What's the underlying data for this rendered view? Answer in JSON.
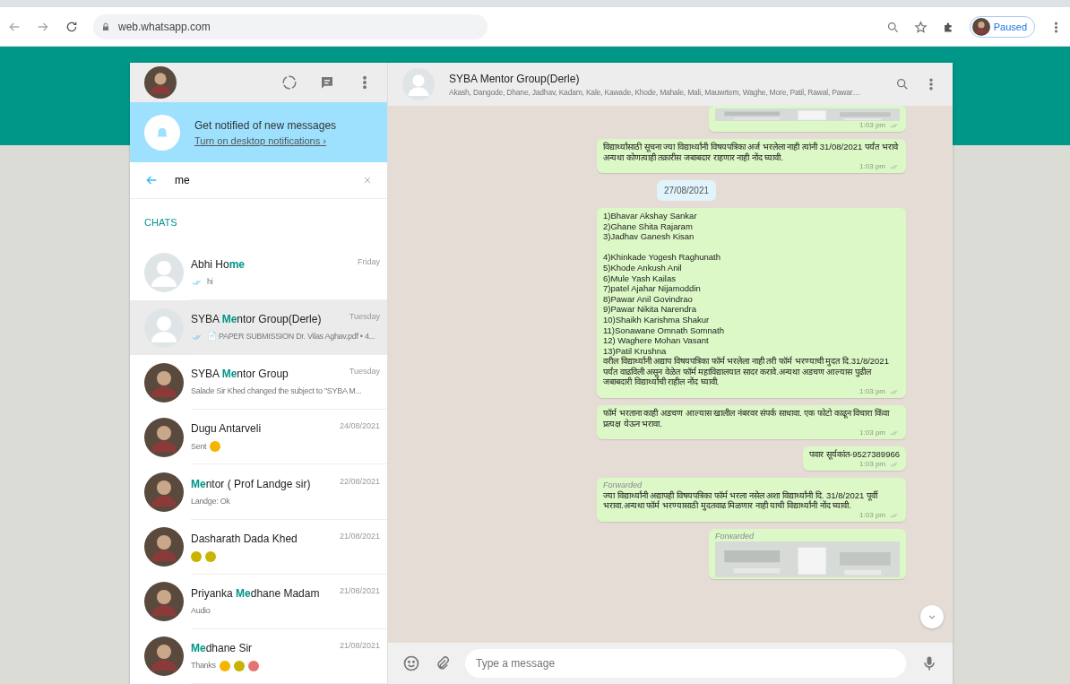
{
  "browser": {
    "url": "web.whatsapp.com",
    "profile_button": "Paused"
  },
  "sidebar": {
    "notification": {
      "title": "Get notified of new messages",
      "link": "Turn on desktop notifications ›"
    },
    "search": {
      "value": "me"
    },
    "section_label": "CHATS",
    "chats": [
      {
        "name_parts": [
          {
            "text": "Abhi Ho",
            "match": false
          },
          {
            "text": "me",
            "match": true
          }
        ],
        "time": "Friday",
        "preview": "hi",
        "tick": true,
        "selected": false
      },
      {
        "name_parts": [
          {
            "text": "SYBA ",
            "match": false
          },
          {
            "text": "Me",
            "match": true
          },
          {
            "text": "ntor Group(Derle)",
            "match": false
          }
        ],
        "time": "Tuesday",
        "preview": "📄 PAPER SUBMISSION Dr. Vilas Aghav.pdf • 4...",
        "tick": true,
        "selected": true
      },
      {
        "name_parts": [
          {
            "text": "SYBA ",
            "match": false
          },
          {
            "text": "Me",
            "match": true
          },
          {
            "text": "ntor Group",
            "match": false
          }
        ],
        "time": "Tuesday",
        "preview": "Salade Sir Khed changed the subject to \"SYBA M...",
        "tick": false,
        "selected": false
      },
      {
        "name_parts": [
          {
            "text": "Dugu Antarveli",
            "match": false
          }
        ],
        "time": "24/08/2021",
        "preview": "Sent",
        "tick": false,
        "emojis": [
          {
            "color": "#f5b400"
          }
        ],
        "selected": false
      },
      {
        "name_parts": [
          {
            "text": "Me",
            "match": true
          },
          {
            "text": "ntor ( Prof Landge sir)",
            "match": false
          }
        ],
        "time": "22/08/2021",
        "preview": "Landge: Ok",
        "tick": false,
        "selected": false
      },
      {
        "name_parts": [
          {
            "text": "Dasharath Dada Khed",
            "match": false
          }
        ],
        "time": "21/08/2021",
        "tick": false,
        "emojis": [
          {
            "color": "#c8b400"
          },
          {
            "color": "#c8b401"
          }
        ],
        "selected": false
      },
      {
        "name_parts": [
          {
            "text": "Priyanka ",
            "match": false
          },
          {
            "text": "Me",
            "match": true
          },
          {
            "text": "dhane Madam",
            "match": false
          }
        ],
        "time": "21/08/2021",
        "preview": "Audio",
        "tick": false,
        "selected": false
      },
      {
        "name_parts": [
          {
            "text": "Me",
            "match": true
          },
          {
            "text": "dhane Sir",
            "match": false
          }
        ],
        "time": "21/08/2021",
        "preview": "Thanks",
        "tick": false,
        "emojis": [
          {
            "color": "#f5b400"
          },
          {
            "color": "#c8b400"
          },
          {
            "color": "#e57373"
          }
        ],
        "selected": false
      }
    ]
  },
  "conversation": {
    "title": "SYBA Mentor Group(Derle)",
    "members": "Akash, Dangode, Dhane, Jadhav, Kadam, Kale, Kawade, Khode, Mahale, Mali, Mauwrtem, Waghe, More, Patil, Rawal, Pawar…",
    "messages": [
      {
        "forwarded": false,
        "time": "1:03 pm"
      },
      {
        "kind": "text",
        "forwarded": false,
        "text": "विद्यार्थ्यांसाठी सूचना ज्या विद्यार्थ्यांनी विषयपत्रिका अर्ज भरलेला नाही त्यांनी 31/08/2021 पर्यंत भरावे अन्यथा कोणत्याही तक्रारीस जबाबदार राहणार नाही नोंद घ्यावी.",
        "time": "1:03 pm"
      },
      {
        "kind": "date",
        "text": "27/08/2021"
      },
      {
        "kind": "text",
        "forwarded": false,
        "text": "1)Bhavar Akshay Sankar\n2)Ghane Shita Rajaram\n3)Jadhav Ganesh Kisan\n\n4)Khinkade Yogesh Raghunath\n5)Khode Ankush Anil\n6)Mule Yash Kailas\n7)patel Ajahar Nijamoddin\n8)Pawar Anil Govindrao\n9)Pawar Nikita Narendra\n10)Shaikh Karishma Shakur\n11)Sonawane Omnath Somnath\n12) Waghere Mohan Vasant\n13)Patil Krushna\nवरील विद्यार्थ्यांनी अद्याप विषयपत्रिका फॉर्म भरलेला नाही तरी फॉर्म भरण्याची मुदत दि.31/8/2021 पर्यंत वाढविली असून वेळेत फॉर्म महाविद्यालयात सादर करावे.अन्यथा अडचण आल्यास पुढील जबाबदारी विद्यार्थ्यांची राहील नोंद घ्यावी.",
        "time": "1:03 pm"
      },
      {
        "kind": "text",
        "forwarded": false,
        "text": "फॉर्म भरताना काही अडचण आल्यास खालील नंबरवर संपर्क साधावा. एक फोटो काढून विचारा किंवा प्रत्यक्ष येऊन भरावा.",
        "time": "1:03 pm"
      },
      {
        "kind": "text",
        "forwarded": false,
        "text": "पवार सूर्यकांत-9527389966",
        "time": "1:03 pm"
      },
      {
        "kind": "text",
        "forwarded": true,
        "forward_label": "Forwarded",
        "text": "ज्या विद्यार्थ्यांनी अद्यापही विषयपत्रिका फॉर्म भरला नसेल अशा विद्यार्थ्यांनी दि. 31/8/2021 पूर्वी भरावा.अन्यथा फॉर्म भरण्यासाठी मुदतवाढ मिळणार नाही याची विद्यार्थ्यांनी नोंद घ्यावी.",
        "time": "1:03 pm"
      },
      {
        "forwarded": true,
        "forward_label": "Forwarded"
      }
    ],
    "composer": {
      "placeholder": "Type a message"
    }
  }
}
